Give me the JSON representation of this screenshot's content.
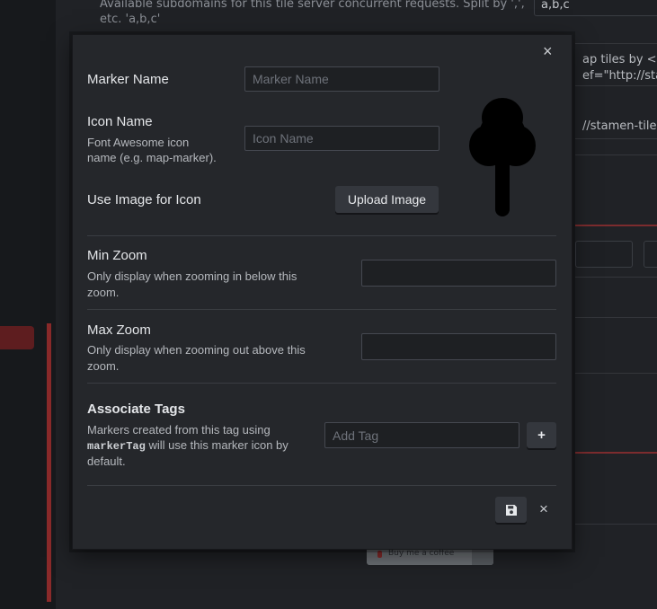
{
  "background": {
    "subdomains_help": "Available subdomains for this tile server concurrent requests. Split by ',', etc. 'a,b,c'",
    "subdomains_help_line1": "Available subdomains for this tile server concurrent requests. Split by ',',",
    "subdomains_help_line2": "etc. 'a,b,c'",
    "subdomains_value": "a,b,c",
    "attribution_snippet_1": "ap tiles by <a",
    "attribution_snippet_2": "ef=\"http://star",
    "url_snippet": "//stamen-tiles",
    "coffee_label": "Buy me a coffee"
  },
  "modal": {
    "close_glyph": "×",
    "marker_name": {
      "label": "Marker Name",
      "placeholder": "Marker Name",
      "value": ""
    },
    "icon_name": {
      "label": "Icon Name",
      "help_line1": "Font Awesome icon",
      "help_line2": "name (e.g. map-marker).",
      "placeholder": "Icon Name",
      "value": ""
    },
    "use_image": {
      "label": "Use Image for Icon",
      "button": "Upload Image"
    },
    "preview_icon": "tree-icon",
    "min_zoom": {
      "label": "Min Zoom",
      "help_line1": "Only display when zooming in below this",
      "help_line2": "zoom.",
      "value": ""
    },
    "max_zoom": {
      "label": "Max Zoom",
      "help_line1": "Only display when zooming out above this",
      "help_line2": "zoom.",
      "value": ""
    },
    "associate_tags": {
      "label": "Associate Tags",
      "help_pre": "Markers created from this tag using",
      "help_code": "markerTag",
      "help_post": "will use this marker icon by",
      "help_end": "default.",
      "placeholder": "Add Tag",
      "add_glyph": "+"
    },
    "footer": {
      "save_icon": "floppy-disk-icon",
      "cancel_glyph": "×"
    }
  }
}
